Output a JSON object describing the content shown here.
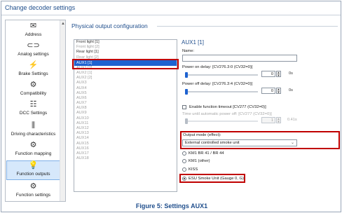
{
  "window": {
    "title": "Change decoder settings"
  },
  "sidebar": {
    "items": [
      {
        "label": "Address",
        "icon": "envelope-icon",
        "glyph": "✉"
      },
      {
        "label": "Analog settings",
        "icon": "analog-icon",
        "glyph": "⊂⊃"
      },
      {
        "label": "Brake Settings",
        "icon": "brake-icon",
        "glyph": "⚡"
      },
      {
        "label": "Compatibility",
        "icon": "compatibility-icon",
        "glyph": "⚙"
      },
      {
        "label": "DCC Settings",
        "icon": "dcc-icon",
        "glyph": "☷"
      },
      {
        "label": "Driving characteristics",
        "icon": "driving-icon",
        "glyph": "⫼"
      },
      {
        "label": "Function mapping",
        "icon": "function-mapping-icon",
        "glyph": "⚙"
      },
      {
        "label": "Function outputs",
        "icon": "function-outputs-icon",
        "glyph": "💡"
      },
      {
        "label": "Function settings",
        "icon": "function-settings-icon",
        "glyph": "⚙"
      }
    ],
    "active_index": 7
  },
  "main": {
    "title": "Physical output configuration"
  },
  "outputs": {
    "items": [
      {
        "label": "Front light [1]",
        "state": "normal"
      },
      {
        "label": "Front light [2]",
        "state": "dim"
      },
      {
        "label": "Rear light [1]",
        "state": "normal"
      },
      {
        "label": "Rear light [2]",
        "state": "dim"
      },
      {
        "label": "AUX1 [1]",
        "state": "selected"
      },
      {
        "label": "AUX1 [2]",
        "state": "dim"
      },
      {
        "label": "AUX2 [1]",
        "state": "dim"
      },
      {
        "label": "AUX2 [2]",
        "state": "dim"
      },
      {
        "label": "AUX3",
        "state": "dim"
      },
      {
        "label": "AUX4",
        "state": "dim"
      },
      {
        "label": "AUX5",
        "state": "dim"
      },
      {
        "label": "AUX6",
        "state": "dim"
      },
      {
        "label": "AUX7",
        "state": "dim"
      },
      {
        "label": "AUX8",
        "state": "dim"
      },
      {
        "label": "AUX9",
        "state": "dim"
      },
      {
        "label": "AUX10",
        "state": "dim"
      },
      {
        "label": "AUX11",
        "state": "dim"
      },
      {
        "label": "AUX12",
        "state": "dim"
      },
      {
        "label": "AUX13",
        "state": "dim"
      },
      {
        "label": "AUX14",
        "state": "dim"
      },
      {
        "label": "AUX15",
        "state": "dim"
      },
      {
        "label": "AUX16",
        "state": "dim"
      },
      {
        "label": "AUX17",
        "state": "dim"
      },
      {
        "label": "AUX18",
        "state": "dim"
      }
    ]
  },
  "panel": {
    "title": "AUX1 [1]",
    "name_label": "Name:",
    "name_value": "",
    "power_on": {
      "label": "Power on delay: [CV276.3:0 (CV32=0)]",
      "value": "0",
      "unit": "0s",
      "level": 0
    },
    "power_off": {
      "label": "Power off delay: [CV276.3:4 (CV32=0)]",
      "value": "0",
      "unit": "0s",
      "level": 0
    },
    "timeout": {
      "checkbox_label": "Enable function timeout [CV277 (CV32=0)]",
      "checked": false
    },
    "auto_off": {
      "label": "Time until automatic power off: [CV277 (CV32=0)]",
      "value": "1",
      "unit": "0.41s",
      "level": 0
    },
    "mode": {
      "label": "Output mode (effect):",
      "value": "External controlled smoke unit"
    },
    "radios": [
      {
        "label": "KM1 BR 41 / BR 44",
        "checked": false
      },
      {
        "label": "KM1 (other)",
        "checked": false
      },
      {
        "label": "KISS",
        "checked": false
      },
      {
        "label": "ESU Smoke Unit (Gauge 0, G)",
        "checked": true
      }
    ]
  },
  "caption": "Figure 5: Settings AUX1",
  "colors": {
    "accent": "#1f4e8c",
    "selection": "#1e62d0",
    "highlight_box": "#c00000"
  }
}
